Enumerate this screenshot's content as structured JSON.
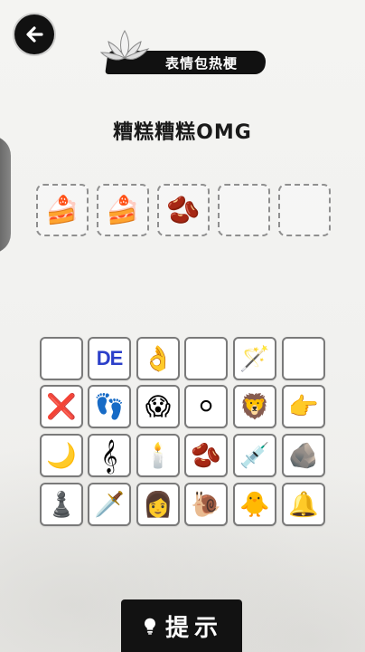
{
  "banner": {
    "title": "表情包热梗"
  },
  "question": {
    "text": "糟糕糟糕OMG"
  },
  "answer_slots": [
    {
      "glyph": "🍰",
      "filled": true
    },
    {
      "glyph": "🍰",
      "filled": true
    },
    {
      "glyph": "🫘",
      "filled": true
    },
    {
      "glyph": "",
      "filled": false
    },
    {
      "glyph": "",
      "filled": false
    }
  ],
  "tile_grid": [
    [
      "",
      "DE",
      "👌",
      "",
      "🪄",
      ""
    ],
    [
      "❌",
      "👣",
      "😱",
      "⚪",
      "🦁",
      "👉"
    ],
    [
      "🌙",
      "𝄞",
      "🕯️",
      "🫘",
      "💉",
      "🪨"
    ],
    [
      "♟️",
      "🗡️",
      "👩",
      "🐌",
      "🐥",
      "🔔"
    ]
  ],
  "hint_button": {
    "label": "提示"
  },
  "colors": {
    "ink": "#111111",
    "tile_border": "#7a7a7a",
    "de_blue": "#2b3fc9"
  }
}
